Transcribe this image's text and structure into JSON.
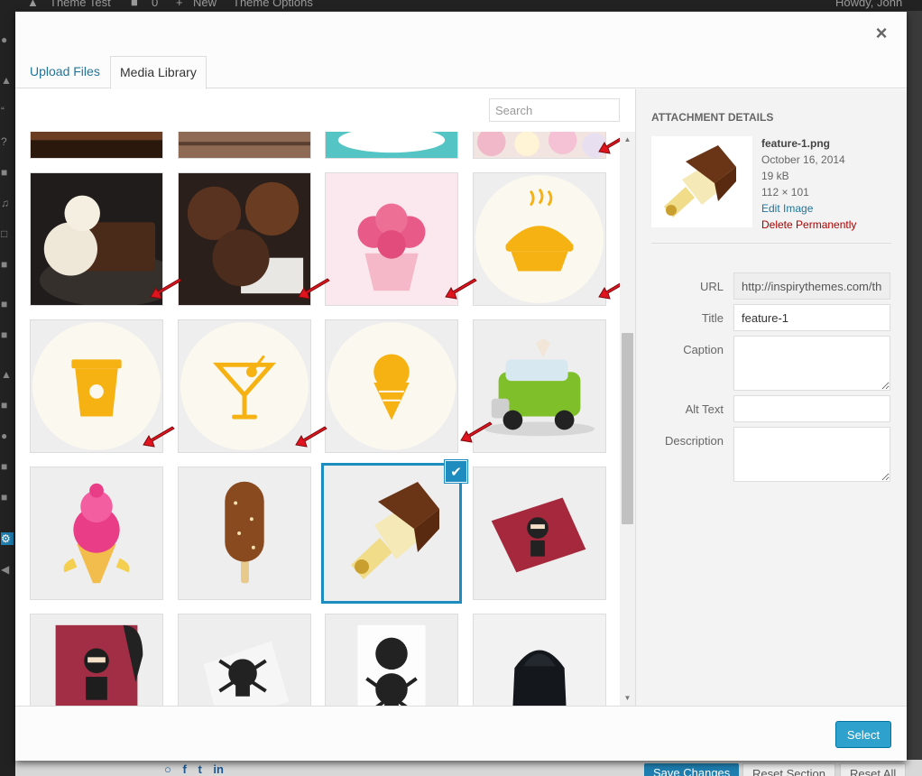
{
  "admin_bar": {
    "site_name": "Theme Test",
    "comments": "0",
    "new": "New",
    "theme_options": "Theme Options",
    "greeting": "Howdy, John"
  },
  "modal": {
    "close_glyph": "×",
    "tabs": [
      {
        "label": "Upload Files",
        "active": false
      },
      {
        "label": "Media Library",
        "active": true
      }
    ],
    "search": {
      "placeholder": "Search",
      "value": ""
    }
  },
  "media_items": [
    {
      "name": "brownie-cake"
    },
    {
      "name": "wood-dessert"
    },
    {
      "name": "doily-dessert"
    },
    {
      "name": "marshmallows"
    },
    {
      "name": "brownie-ice-cream"
    },
    {
      "name": "chocolate-muffins"
    },
    {
      "name": "rose-cupcake"
    },
    {
      "name": "pie-icon"
    },
    {
      "name": "coffee-cup-icon"
    },
    {
      "name": "martini-icon"
    },
    {
      "name": "ice-cream-cone-icon"
    },
    {
      "name": "ice-cream-truck"
    },
    {
      "name": "pink-ice-cream"
    },
    {
      "name": "chocolate-popsicle"
    },
    {
      "name": "feature-1",
      "selected": true
    },
    {
      "name": "ninja-poster"
    },
    {
      "name": "poster-held-ninja"
    },
    {
      "name": "skull-poster"
    },
    {
      "name": "ship-your-idea-poster"
    },
    {
      "name": "hoodie"
    }
  ],
  "selection_check": "✔",
  "attachment": {
    "heading": "Attachment Details",
    "filename": "feature-1.png",
    "date": "October 16, 2014",
    "size": "19 kB",
    "dimensions": "112 × 101",
    "edit_link": "Edit Image",
    "delete_link": "Delete Permanently",
    "fields": {
      "url_label": "URL",
      "url_value": "http://inspirythemes.com/th",
      "title_label": "Title",
      "title_value": "feature-1",
      "caption_label": "Caption",
      "alt_label": "Alt Text",
      "description_label": "Description"
    }
  },
  "toolbar": {
    "select_label": "Select"
  },
  "background_footer": {
    "save_changes": "Save Changes",
    "reset_section": "Reset Section",
    "reset_all": "Reset All"
  },
  "colors": {
    "accent": "#2ea2cc",
    "selection_border": "#1e8cbe",
    "link": "#21759b",
    "danger": "#a00000",
    "arrow": "#e0141e"
  }
}
